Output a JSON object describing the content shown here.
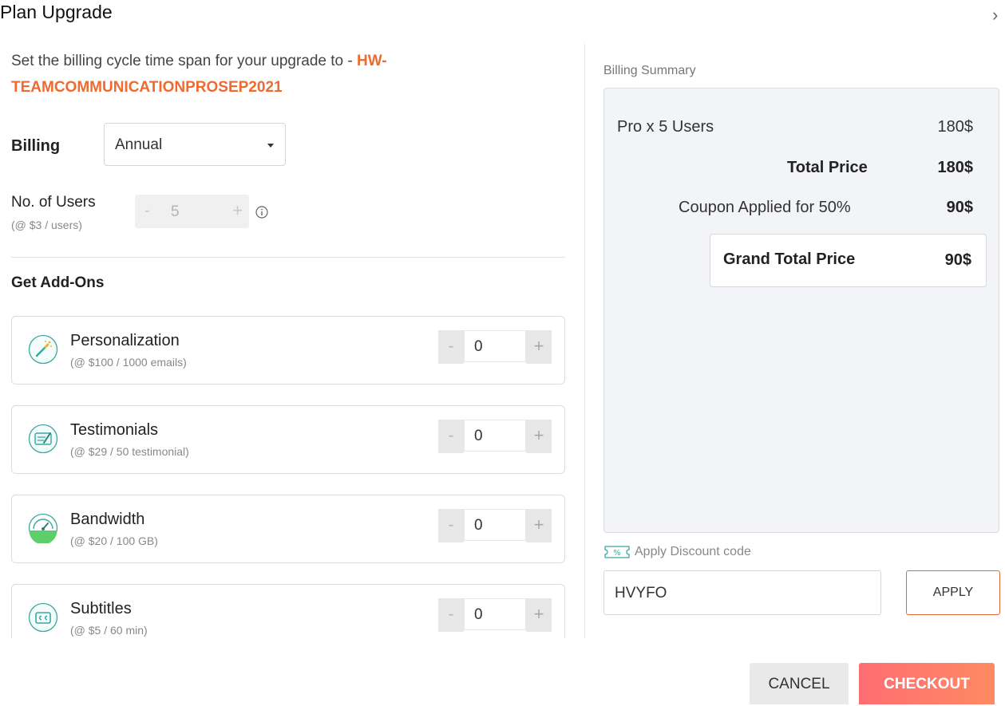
{
  "modal": {
    "title": "Plan Upgrade",
    "close_icon": "close-icon",
    "close_glyph": "›"
  },
  "intro": {
    "text": "Set the billing cycle time span for your upgrade to - ",
    "plan_name": "HW-TEAMCOMMUNICATIONPROSEP2021"
  },
  "billing": {
    "label": "Billing",
    "selected": "Annual"
  },
  "users": {
    "label": "No. of Users",
    "rate": "(@ $3 / users)",
    "minus": "-",
    "value": "5",
    "plus": "+"
  },
  "addons": {
    "title": "Get Add-Ons",
    "items": [
      {
        "name": "Personalization",
        "rate": "(@ $100 / 1000 emails)",
        "value": "0",
        "minus": "-",
        "plus": "+",
        "icon": "magic-wand-icon"
      },
      {
        "name": "Testimonials",
        "rate": "(@ $29 / 50 testimonial)",
        "value": "0",
        "minus": "-",
        "plus": "+",
        "icon": "testimonial-icon"
      },
      {
        "name": "Bandwidth",
        "rate": "(@ $20 / 100 GB)",
        "value": "0",
        "minus": "-",
        "plus": "+",
        "icon": "speedometer-icon"
      },
      {
        "name": "Subtitles",
        "rate": "(@ $5 / 60 min)",
        "value": "0",
        "minus": "-",
        "plus": "+",
        "icon": "subtitles-cc-icon"
      }
    ]
  },
  "summary": {
    "label": "Billing Summary",
    "rows": [
      {
        "label": "Pro x 5 Users",
        "value": "180$"
      },
      {
        "label": "Total Price",
        "value": "180$"
      },
      {
        "label": "Coupon Applied for 50%",
        "value": "90$"
      }
    ],
    "grand_label": "Grand Total Price",
    "grand_value": "90$"
  },
  "discount": {
    "label": "Apply Discount code",
    "code": "HVYFO",
    "apply": "APPLY"
  },
  "footer": {
    "cancel": "CANCEL",
    "checkout": "CHECKOUT"
  },
  "colors": {
    "accent": "#ef6a2f",
    "checkout_start": "#ff6d73",
    "checkout_end": "#ff8a63"
  }
}
